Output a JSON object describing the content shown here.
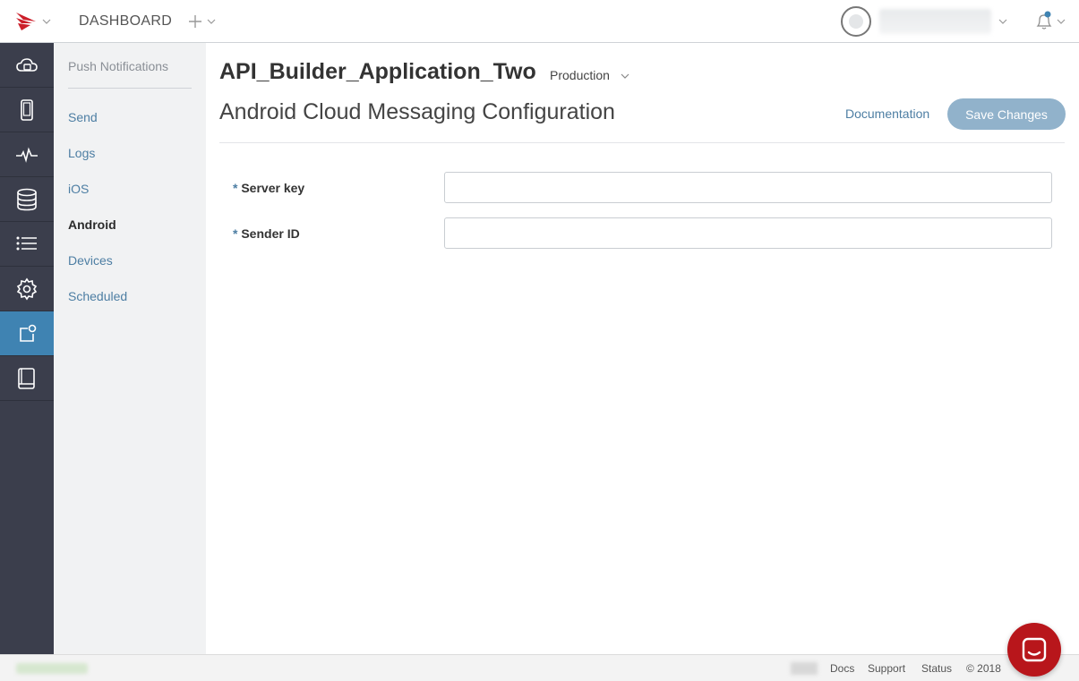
{
  "header": {
    "dashboard_label": "DASHBOARD",
    "add_icon": "plus-icon",
    "bell_icon": "bell-icon",
    "brand_color": "#cc1f2a"
  },
  "rail": {
    "items": [
      {
        "icon": "cloud-icon"
      },
      {
        "icon": "mobile-icon"
      },
      {
        "icon": "activity-icon"
      },
      {
        "icon": "database-icon"
      },
      {
        "icon": "list-icon"
      },
      {
        "icon": "gear-icon"
      },
      {
        "icon": "push-notification-icon",
        "active": true
      },
      {
        "icon": "book-icon"
      }
    ]
  },
  "subnav": {
    "title": "Push Notifications",
    "items": [
      {
        "label": "Send"
      },
      {
        "label": "Logs"
      },
      {
        "label": "iOS"
      },
      {
        "label": "Android",
        "active": true
      },
      {
        "label": "Devices"
      },
      {
        "label": "Scheduled"
      }
    ]
  },
  "main": {
    "app_name": "API_Builder_Application_Two",
    "environment": "Production",
    "page_title": "Android Cloud Messaging Configuration",
    "documentation_label": "Documentation",
    "save_label": "Save Changes",
    "fields": [
      {
        "required_mark": "*",
        "label": "Server key",
        "value": ""
      },
      {
        "required_mark": "*",
        "label": "Sender ID",
        "value": ""
      }
    ]
  },
  "footer": {
    "links": [
      "Docs",
      "Support",
      "Status"
    ],
    "copyright": "© 2018"
  },
  "colors": {
    "rail_bg": "#3b3e4c",
    "rail_active": "#3f83b2",
    "link": "#4d7ea3",
    "save_button": "#91b2cb",
    "chat_button": "#b8161b"
  }
}
